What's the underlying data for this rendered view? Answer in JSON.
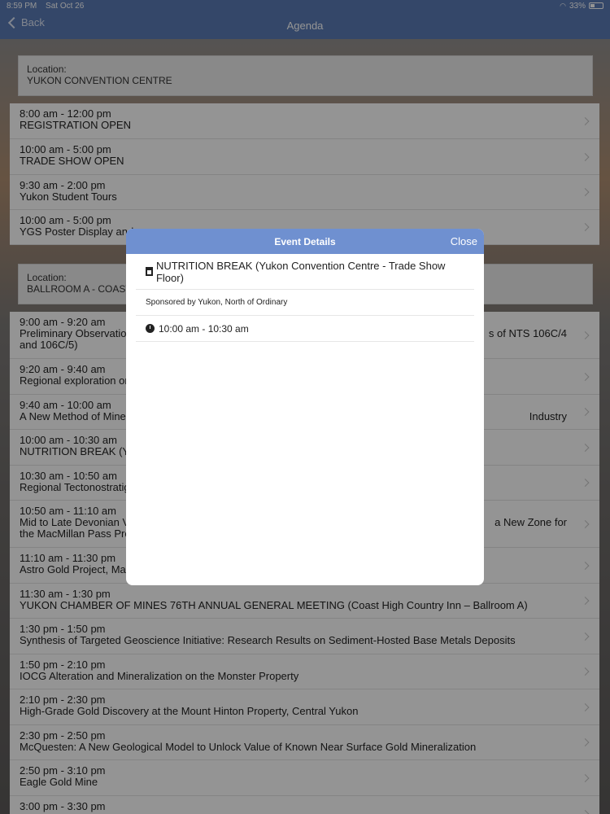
{
  "status_bar": {
    "time": "8:59 PM",
    "date": "Sat Oct 26",
    "battery": "33%"
  },
  "nav": {
    "back_label": "Back",
    "title": "Agenda"
  },
  "sections": [
    {
      "location_label": "Location:",
      "location_value": "YUKON CONVENTION CENTRE",
      "items": [
        {
          "time": "8:00 am - 12:00 pm",
          "title": "REGISTRATION OPEN"
        },
        {
          "time": "10:00 am - 5:00 pm",
          "title": "TRADE SHOW OPEN"
        },
        {
          "time": "9:30 am - 2:00 pm",
          "title": "Yukon Student Tours"
        },
        {
          "time": "10:00 am - 5:00 pm",
          "title": "YGS Poster Display and"
        }
      ]
    },
    {
      "location_label": "Location:",
      "location_value": "BALLROOM A - COAST",
      "items": [
        {
          "time": "9:00 am - 9:20 am",
          "title": "Preliminary Observation",
          "title_right": "s of NTS 106C/4",
          "title2": "and 106C/5)"
        },
        {
          "time": "9:20 am - 9:40 am",
          "title": "Regional exploration on"
        },
        {
          "time": "9:40 am - 10:00 am",
          "title": "A New Method of Miner",
          "title_right": "Industry"
        },
        {
          "time": "10:00 am - 10:30 am",
          "title": "NUTRITION BREAK (Yu"
        },
        {
          "time": "10:30 am - 10:50 am",
          "title": "Regional Tectonostratig"
        },
        {
          "time": "10:50 am - 11:10 am",
          "title": "Mid to Late Devonian Vo",
          "title_right": "a New Zone for",
          "title2": "the MacMillan Pass Proj"
        },
        {
          "time": "11:10 am - 11:30 pm",
          "title": "Astro Gold Project, Mac"
        },
        {
          "time": "11:30 am - 1:30 pm",
          "title": "YUKON CHAMBER OF MINES 76TH ANNUAL GENERAL MEETING (Coast High Country Inn – Ballroom A)"
        },
        {
          "time": "1:30 pm - 1:50 pm",
          "title": "Synthesis of Targeted Geoscience Initiative: Research Results on Sediment-Hosted Base Metals Deposits"
        },
        {
          "time": "1:50 pm - 2:10 pm",
          "title": "IOCG Alteration and Mineralization on the Monster Property"
        },
        {
          "time": "2:10 pm - 2:30 pm",
          "title": "High-Grade Gold Discovery at the Mount Hinton Property, Central Yukon"
        },
        {
          "time": "2:30 pm - 2:50 pm",
          "title": "McQuesten: A New Geological Model to Unlock Value of Known Near Surface Gold Mineralization"
        },
        {
          "time": "2:50 pm - 3:10 pm",
          "title": "Eagle Gold Mine"
        },
        {
          "time": "3:00 pm - 3:30 pm",
          "title": ""
        }
      ]
    }
  ],
  "modal": {
    "title": "Event Details",
    "close_label": "Close",
    "event_title": "NUTRITION BREAK (Yukon Convention Centre - Trade Show Floor)",
    "sponsor": "Sponsored by Yukon, North of Ordinary",
    "time": "10:00 am - 10:30 am",
    "icons": [
      "calendar-icon",
      "clock-icon"
    ]
  }
}
